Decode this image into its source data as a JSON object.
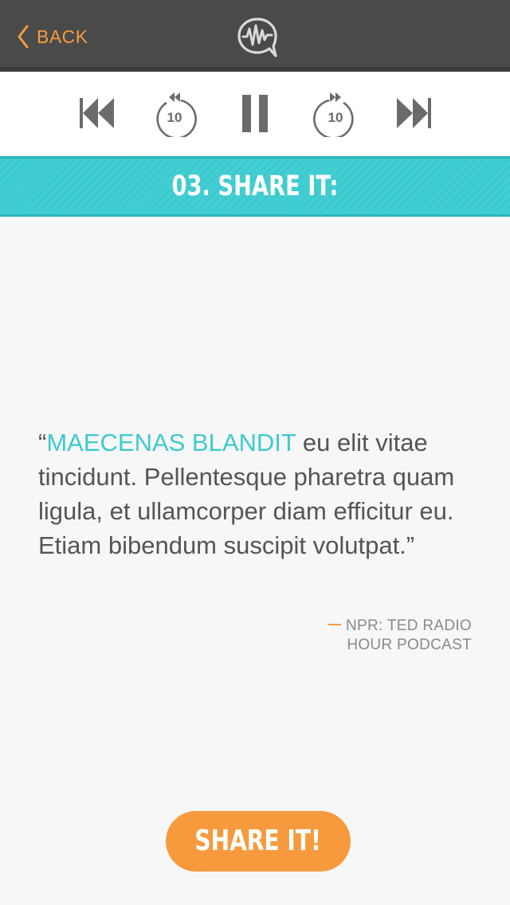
{
  "nav": {
    "back_label": "BACK",
    "logo_icon": "speech-bubble-waveform-icon"
  },
  "player": {
    "controls": [
      {
        "name": "previous-track-button",
        "icon": "skip-previous-icon"
      },
      {
        "name": "rewind-10-button",
        "icon": "rewind-10-icon",
        "label": "10"
      },
      {
        "name": "pause-button",
        "icon": "pause-icon"
      },
      {
        "name": "forward-10-button",
        "icon": "forward-10-icon",
        "label": "10"
      },
      {
        "name": "next-track-button",
        "icon": "skip-next-icon"
      }
    ],
    "rewind_label": "10",
    "forward_label": "10"
  },
  "section": {
    "title": "03. SHARE IT:"
  },
  "quote": {
    "open_mark": "“",
    "highlight": "MAECENAS BLANDIT",
    "body": " eu elit vitae tincidunt. Pellentesque pharetra quam ligula, et ullamcorper diam efficitur eu. Etiam bibendum suscipit volutpat.",
    "close_mark": "”",
    "attribution_line1": "NPR: TED RADIO",
    "attribution_line2": "HOUR PODCAST"
  },
  "share_button": {
    "label": "SHARE IT!"
  },
  "colors": {
    "topbar": "#4a4a4a",
    "accent_orange": "#f79a3d",
    "accent_teal": "#3ccbd0",
    "body_text": "#555555",
    "icon_gray": "#6b6b6b"
  }
}
